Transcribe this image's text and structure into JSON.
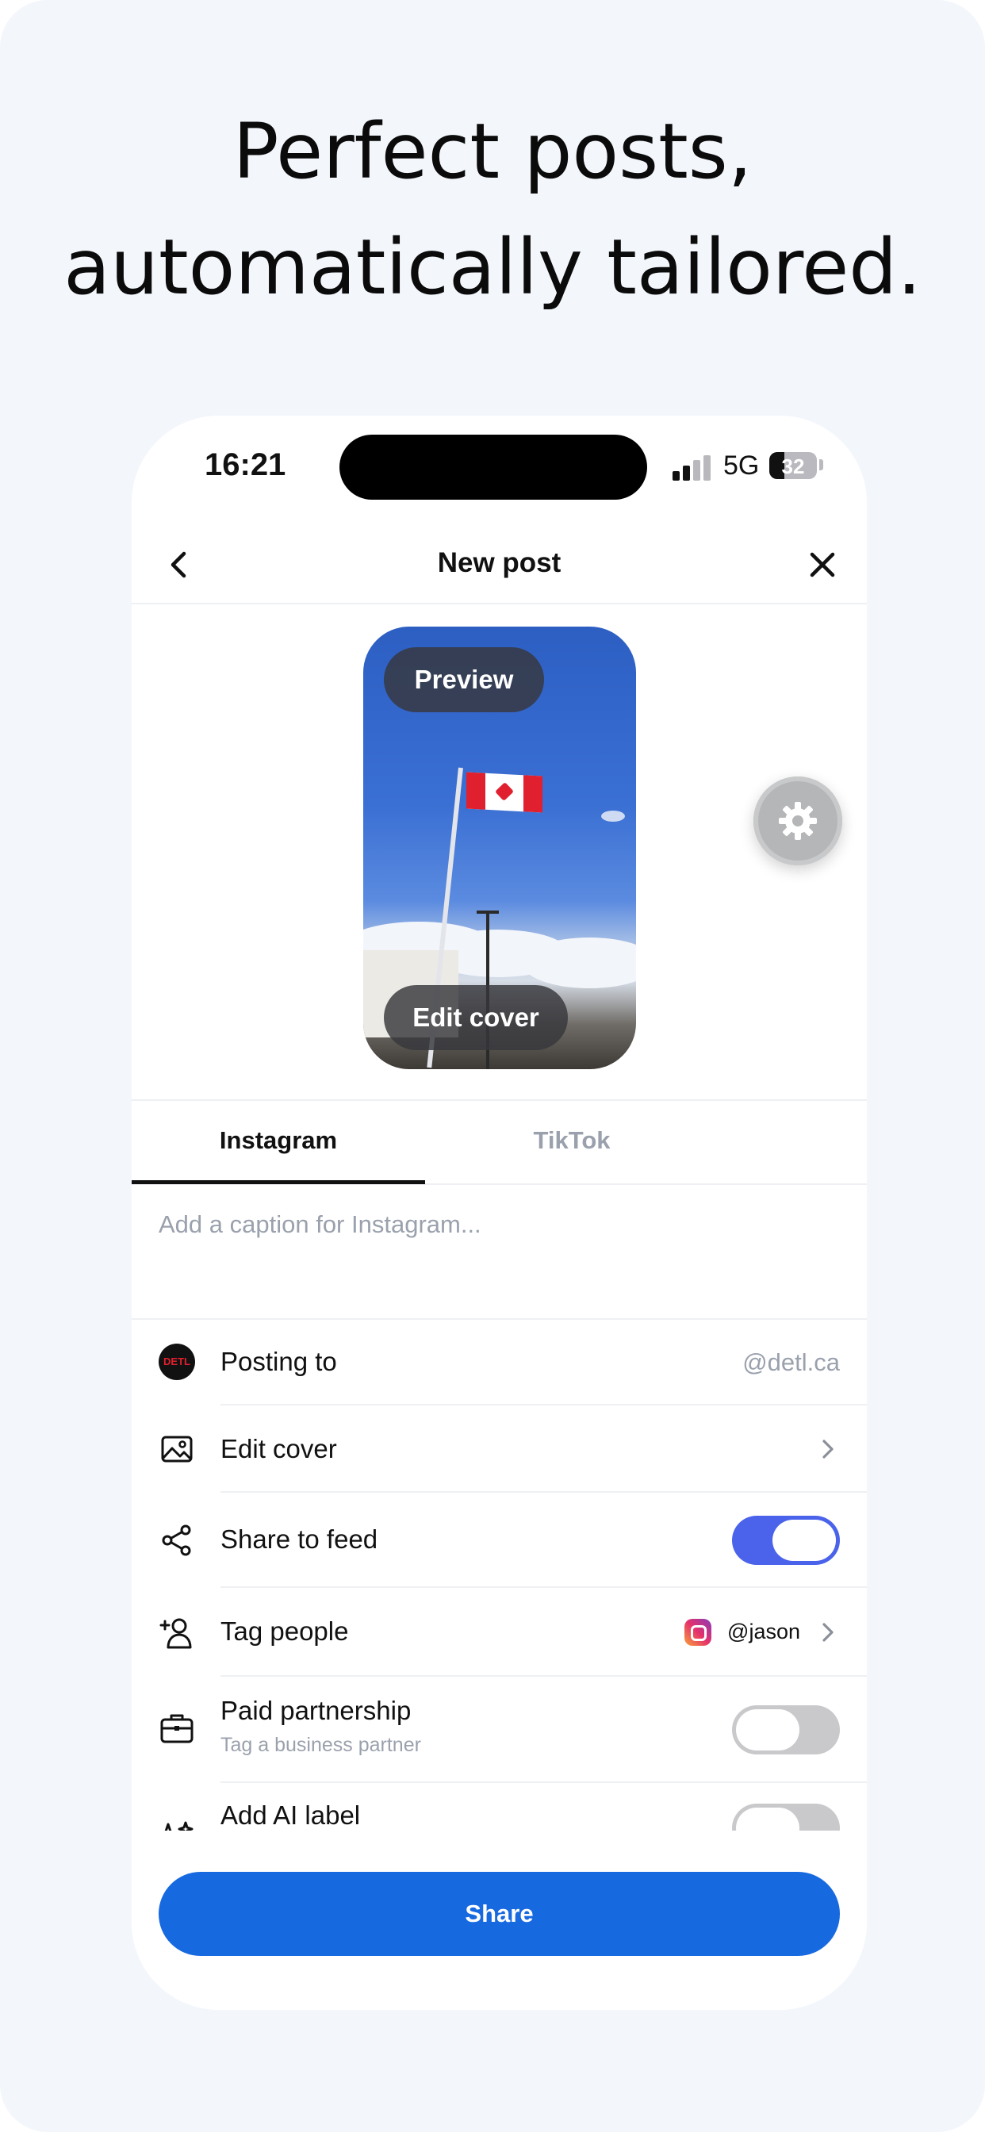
{
  "headline": {
    "line1": "Perfect posts,",
    "line2": "automatically tailored."
  },
  "status_bar": {
    "time": "16:21",
    "network": "5G",
    "battery_percent": "32"
  },
  "nav": {
    "title": "New post"
  },
  "media": {
    "preview_label": "Preview",
    "edit_cover_label": "Edit cover"
  },
  "tabs": [
    {
      "label": "Instagram",
      "active": true
    },
    {
      "label": "TikTok",
      "active": false
    }
  ],
  "caption": {
    "placeholder": "Add a caption for Instagram..."
  },
  "settings": {
    "posting_to": {
      "label": "Posting to",
      "account_logo": "DETL",
      "value": "@detl.ca"
    },
    "edit_cover": {
      "label": "Edit cover"
    },
    "share_to_feed": {
      "label": "Share to feed",
      "enabled": true
    },
    "tag_people": {
      "label": "Tag people",
      "tagged_user": "@jason"
    },
    "paid_partnership": {
      "label": "Paid partnership",
      "sublabel": "Tag a business partner",
      "enabled": false
    },
    "add_ai_label": {
      "label": "Add AI label",
      "enabled": false
    }
  },
  "share_button": {
    "label": "Share"
  },
  "colors": {
    "background": "#f3f6fb",
    "toggle_on": "#4a63ea",
    "toggle_off": "#c9c9cc",
    "share_button": "#1769e0"
  }
}
